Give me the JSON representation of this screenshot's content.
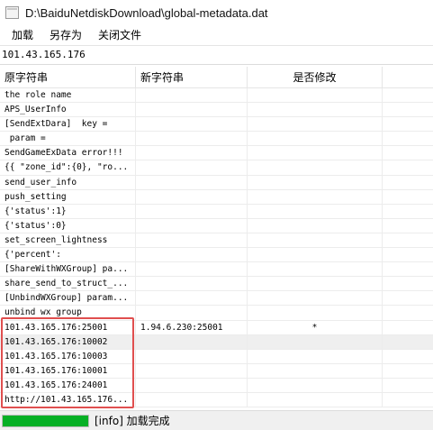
{
  "window": {
    "title": "D:\\BaiduNetdiskDownload\\global-metadata.dat",
    "icon": "document-icon"
  },
  "menu": [
    {
      "label": "加载"
    },
    {
      "label": "另存为"
    },
    {
      "label": "关闭文件"
    }
  ],
  "path_field": {
    "value": "101.43.165.176"
  },
  "table": {
    "columns": [
      "原字符串",
      "新字符串",
      "是否修改",
      ""
    ],
    "rows": [
      [
        "the role name",
        "",
        ""
      ],
      [
        "APS_UserInfo",
        "",
        ""
      ],
      [
        "[SendExtDara]  key =",
        "",
        ""
      ],
      [
        " param =",
        "",
        ""
      ],
      [
        "SendGameExData error!!!",
        "",
        ""
      ],
      [
        "{{ \"zone_id\":{0}, \"ro...",
        "",
        ""
      ],
      [
        "send_user_info",
        "",
        ""
      ],
      [
        "push_setting",
        "",
        ""
      ],
      [
        "{'status':1}",
        "",
        ""
      ],
      [
        "{'status':0}",
        "",
        ""
      ],
      [
        "set_screen_lightness",
        "",
        ""
      ],
      [
        "{'percent':",
        "",
        ""
      ],
      [
        "[ShareWithWXGroup] pa...",
        "",
        ""
      ],
      [
        "share_send_to_struct_...",
        "",
        ""
      ],
      [
        "[UnbindWXGroup] param...",
        "",
        ""
      ],
      [
        "unbind wx group",
        "",
        ""
      ],
      [
        "101.43.165.176:25001",
        "1.94.6.230:25001",
        "*"
      ],
      [
        "101.43.165.176:10002",
        "",
        ""
      ],
      [
        "101.43.165.176:10003",
        "",
        ""
      ],
      [
        "101.43.165.176:10001",
        "",
        ""
      ],
      [
        "101.43.165.176:24001",
        "",
        ""
      ],
      [
        "http://101.43.165.176...",
        "",
        ""
      ]
    ],
    "selected_row": 17
  },
  "status": {
    "progress_percent": 100,
    "text": "[info] 加载完成"
  },
  "colors": {
    "highlight_border": "#e04f4f",
    "progress_fill": "#06b025",
    "selected_row": "#efefef"
  }
}
